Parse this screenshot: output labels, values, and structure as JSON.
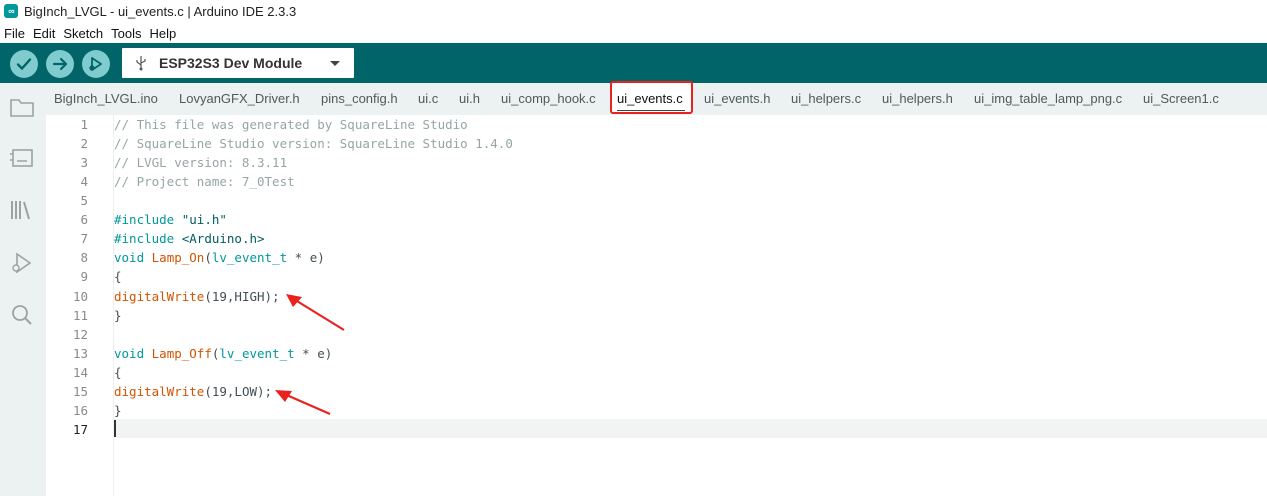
{
  "window": {
    "logo_text": "∞",
    "title": "BigInch_LVGL - ui_events.c | Arduino IDE 2.3.3"
  },
  "menu": [
    "File",
    "Edit",
    "Sketch",
    "Tools",
    "Help"
  ],
  "toolbar": {
    "buttons": [
      {
        "name": "verify",
        "icon": "check-icon"
      },
      {
        "name": "upload",
        "icon": "arrow-right-icon"
      },
      {
        "name": "debug",
        "icon": "debug-icon"
      }
    ],
    "board": "ESP32S3 Dev Module",
    "accent_color": "#006468"
  },
  "sidebar_icons": [
    "sketchbook-folder-icon",
    "boards-manager-icon",
    "library-manager-icon",
    "debug-icon",
    "search-icon"
  ],
  "tabs": [
    "BigInch_LVGL.ino",
    "LovyanGFX_Driver.h",
    "pins_config.h",
    "ui.c",
    "ui.h",
    "ui_comp_hook.c",
    "ui_events.c",
    "ui_events.h",
    "ui_helpers.c",
    "ui_helpers.h",
    "ui_img_table_lamp_png.c",
    "ui_Screen1.c"
  ],
  "active_tab": "ui_events.c",
  "code_lines": [
    {
      "n": "1",
      "tokens": [
        [
          "c-comment",
          "// This file was generated by SquareLine Studio"
        ]
      ]
    },
    {
      "n": "2",
      "tokens": [
        [
          "c-comment",
          "// SquareLine Studio version: SquareLine Studio 1.4.0"
        ]
      ]
    },
    {
      "n": "3",
      "tokens": [
        [
          "c-comment",
          "// LVGL version: 8.3.11"
        ]
      ]
    },
    {
      "n": "4",
      "tokens": [
        [
          "c-comment",
          "// Project name: 7_0Test"
        ]
      ]
    },
    {
      "n": "5",
      "tokens": []
    },
    {
      "n": "6",
      "tokens": [
        [
          "c-keyword",
          "#include"
        ],
        [
          "c-plain",
          " "
        ],
        [
          "c-string",
          "\"ui.h\""
        ]
      ]
    },
    {
      "n": "7",
      "tokens": [
        [
          "c-keyword",
          "#include"
        ],
        [
          "c-plain",
          " "
        ],
        [
          "c-string",
          "<Arduino.h>"
        ]
      ]
    },
    {
      "n": "8",
      "tokens": [
        [
          "c-keyword",
          "void"
        ],
        [
          "c-plain",
          " "
        ],
        [
          "c-fn",
          "Lamp_On"
        ],
        [
          "c-plain",
          "("
        ],
        [
          "c-type",
          "lv_event_t"
        ],
        [
          "c-plain",
          " * e)"
        ]
      ]
    },
    {
      "n": "9",
      "tokens": [
        [
          "c-plain",
          "{"
        ]
      ]
    },
    {
      "n": "10",
      "tokens": [
        [
          "c-fn",
          "digitalWrite"
        ],
        [
          "c-plain",
          "(19,HIGH);"
        ]
      ]
    },
    {
      "n": "11",
      "tokens": [
        [
          "c-plain",
          "}"
        ]
      ]
    },
    {
      "n": "12",
      "tokens": []
    },
    {
      "n": "13",
      "tokens": [
        [
          "c-keyword",
          "void"
        ],
        [
          "c-plain",
          " "
        ],
        [
          "c-fn",
          "Lamp_Off"
        ],
        [
          "c-plain",
          "("
        ],
        [
          "c-type",
          "lv_event_t"
        ],
        [
          "c-plain",
          " * e)"
        ]
      ]
    },
    {
      "n": "14",
      "tokens": [
        [
          "c-plain",
          "{"
        ]
      ]
    },
    {
      "n": "15",
      "tokens": [
        [
          "c-fn",
          "digitalWrite"
        ],
        [
          "c-plain",
          "(19,LOW);"
        ]
      ]
    },
    {
      "n": "16",
      "tokens": [
        [
          "c-plain",
          "}"
        ]
      ]
    },
    {
      "n": "17",
      "tokens": []
    }
  ],
  "current_line": "17",
  "annotation_color": "#e8231e"
}
